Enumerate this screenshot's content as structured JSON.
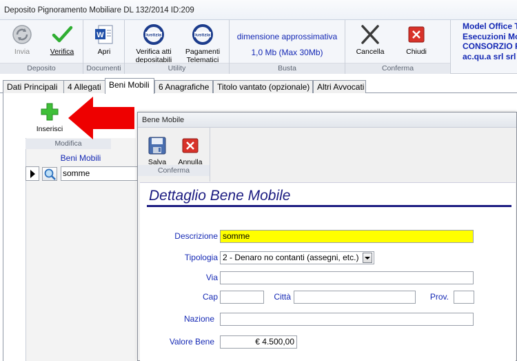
{
  "window": {
    "title": "Deposito Pignoramento Mobiliare DL 132/2014 ID:209"
  },
  "ribbon": {
    "groups": {
      "deposito": "Deposito",
      "documenti": "Documenti",
      "utility": "Utility",
      "busta": "Busta",
      "conferma": "Conferma"
    },
    "buttons": {
      "invia": "Invia",
      "verifica": "Verifica",
      "apri": "Apri",
      "verifica_atti_1": "Verifica atti",
      "verifica_atti_2": "depositabili",
      "pagamenti_1": "Pagamenti",
      "pagamenti_2": "Telematici",
      "cancella": "Cancella",
      "chiudi": "Chiudi",
      "giustizia_icon_text": "iustizia"
    },
    "busta": {
      "line1": "dimensione approssimativa",
      "line2": "1,0 Mb (Max 30Mb)"
    },
    "company": [
      "Model Office Ti",
      "Esecuzioni Mo",
      "CONSORZIO R",
      "ac.qu.a srl srl"
    ]
  },
  "tabs": [
    "Dati Principali",
    "4 Allegati",
    "Beni Mobili",
    "6 Anagrafiche",
    "Titolo vantato (opzionale)",
    "Altri Avvocati"
  ],
  "left_panel": {
    "inserisci": "Inserisci",
    "modifica": "Modifica",
    "list_header": "Beni Mobili",
    "rows": [
      "somme"
    ]
  },
  "dialog": {
    "title": "Bene Mobile",
    "salva": "Salva",
    "annulla": "Annulla",
    "conferma": "Conferma",
    "heading": "Dettaglio Bene Mobile",
    "fields": {
      "descrizione_label": "Descrizione",
      "descrizione_value": "somme",
      "tipologia_label": "Tipologia",
      "tipologia_value": "2 - Denaro no contanti (assegni, etc.)",
      "via_label": "Via",
      "via_value": "",
      "cap_label": "Cap",
      "cap_value": "",
      "citta_label": "Città",
      "citta_value": "",
      "prov_label": "Prov.",
      "prov_value": "",
      "nazione_label": "Nazione",
      "nazione_value": "",
      "valore_label": "Valore Bene",
      "valore_value": "€ 4.500,00"
    }
  },
  "colors": {
    "accent_blue": "#1428b4",
    "heading_navy": "#1a1a80",
    "highlight_yellow": "#ffff00",
    "annotation_red": "#ee0000"
  }
}
